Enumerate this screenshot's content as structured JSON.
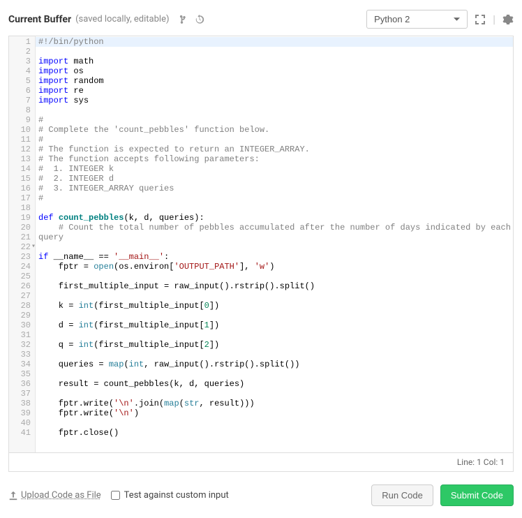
{
  "header": {
    "title": "Current Buffer",
    "subtitle": "(saved locally, editable)",
    "language": "Python 2"
  },
  "code_lines": [
    {
      "n": 1,
      "hl": true,
      "seg": [
        {
          "c": "tok-comment",
          "t": "#!/bin/python"
        }
      ]
    },
    {
      "n": 2,
      "seg": []
    },
    {
      "n": 3,
      "seg": [
        {
          "c": "tok-keyword",
          "t": "import"
        },
        {
          "t": " math"
        }
      ]
    },
    {
      "n": 4,
      "seg": [
        {
          "c": "tok-keyword",
          "t": "import"
        },
        {
          "t": " os"
        }
      ]
    },
    {
      "n": 5,
      "seg": [
        {
          "c": "tok-keyword",
          "t": "import"
        },
        {
          "t": " random"
        }
      ]
    },
    {
      "n": 6,
      "seg": [
        {
          "c": "tok-keyword",
          "t": "import"
        },
        {
          "t": " re"
        }
      ]
    },
    {
      "n": 7,
      "seg": [
        {
          "c": "tok-keyword",
          "t": "import"
        },
        {
          "t": " sys"
        }
      ]
    },
    {
      "n": 8,
      "seg": []
    },
    {
      "n": 9,
      "seg": [
        {
          "c": "tok-comment",
          "t": "#"
        }
      ]
    },
    {
      "n": 10,
      "seg": [
        {
          "c": "tok-comment",
          "t": "# Complete the 'count_pebbles' function below."
        }
      ]
    },
    {
      "n": 11,
      "seg": [
        {
          "c": "tok-comment",
          "t": "#"
        }
      ]
    },
    {
      "n": 12,
      "seg": [
        {
          "c": "tok-comment",
          "t": "# The function is expected to return an INTEGER_ARRAY."
        }
      ]
    },
    {
      "n": 13,
      "seg": [
        {
          "c": "tok-comment",
          "t": "# The function accepts following parameters:"
        }
      ]
    },
    {
      "n": 14,
      "seg": [
        {
          "c": "tok-comment",
          "t": "#  1. INTEGER k"
        }
      ]
    },
    {
      "n": 15,
      "seg": [
        {
          "c": "tok-comment",
          "t": "#  2. INTEGER d"
        }
      ]
    },
    {
      "n": 16,
      "seg": [
        {
          "c": "tok-comment",
          "t": "#  3. INTEGER_ARRAY queries"
        }
      ]
    },
    {
      "n": 17,
      "seg": [
        {
          "c": "tok-comment",
          "t": "#"
        }
      ]
    },
    {
      "n": 18,
      "seg": []
    },
    {
      "n": 19,
      "seg": [
        {
          "c": "tok-keyword",
          "t": "def"
        },
        {
          "t": " "
        },
        {
          "c": "tok-def",
          "t": "count_pebbles"
        },
        {
          "t": "(k, d, queries):"
        }
      ]
    },
    {
      "n": 20,
      "wrap": true,
      "seg": [
        {
          "t": "    "
        },
        {
          "c": "tok-comment",
          "t": "# Count the total number of pebbles accumulated after the number of days indicated by each query"
        }
      ]
    },
    {
      "n": 21,
      "seg": []
    },
    {
      "n": 22,
      "fold": true,
      "seg": [
        {
          "c": "tok-keyword",
          "t": "if"
        },
        {
          "t": " __name__ == "
        },
        {
          "c": "tok-string",
          "t": "'__main__'"
        },
        {
          "t": ":"
        }
      ]
    },
    {
      "n": 23,
      "seg": [
        {
          "t": "    fptr = "
        },
        {
          "c": "tok-builtin",
          "t": "open"
        },
        {
          "t": "(os.environ["
        },
        {
          "c": "tok-string",
          "t": "'OUTPUT_PATH'"
        },
        {
          "t": "], "
        },
        {
          "c": "tok-string",
          "t": "'w'"
        },
        {
          "t": ")"
        }
      ]
    },
    {
      "n": 24,
      "seg": []
    },
    {
      "n": 25,
      "seg": [
        {
          "t": "    first_multiple_input = raw_input().rstrip().split()"
        }
      ]
    },
    {
      "n": 26,
      "seg": []
    },
    {
      "n": 27,
      "seg": [
        {
          "t": "    k = "
        },
        {
          "c": "tok-builtin",
          "t": "int"
        },
        {
          "t": "(first_multiple_input["
        },
        {
          "c": "tok-num",
          "t": "0"
        },
        {
          "t": "])"
        }
      ]
    },
    {
      "n": 28,
      "seg": []
    },
    {
      "n": 29,
      "seg": [
        {
          "t": "    d = "
        },
        {
          "c": "tok-builtin",
          "t": "int"
        },
        {
          "t": "(first_multiple_input["
        },
        {
          "c": "tok-num",
          "t": "1"
        },
        {
          "t": "])"
        }
      ]
    },
    {
      "n": 30,
      "seg": []
    },
    {
      "n": 31,
      "seg": [
        {
          "t": "    q = "
        },
        {
          "c": "tok-builtin",
          "t": "int"
        },
        {
          "t": "(first_multiple_input["
        },
        {
          "c": "tok-num",
          "t": "2"
        },
        {
          "t": "])"
        }
      ]
    },
    {
      "n": 32,
      "seg": []
    },
    {
      "n": 33,
      "seg": [
        {
          "t": "    queries = "
        },
        {
          "c": "tok-builtin",
          "t": "map"
        },
        {
          "t": "("
        },
        {
          "c": "tok-builtin",
          "t": "int"
        },
        {
          "t": ", raw_input().rstrip().split())"
        }
      ]
    },
    {
      "n": 34,
      "seg": []
    },
    {
      "n": 35,
      "seg": [
        {
          "t": "    result = count_pebbles(k, d, queries)"
        }
      ]
    },
    {
      "n": 36,
      "seg": []
    },
    {
      "n": 37,
      "seg": [
        {
          "t": "    fptr.write("
        },
        {
          "c": "tok-string",
          "t": "'\\n'"
        },
        {
          "t": ".join("
        },
        {
          "c": "tok-builtin",
          "t": "map"
        },
        {
          "t": "("
        },
        {
          "c": "tok-builtin",
          "t": "str"
        },
        {
          "t": ", result)))"
        }
      ]
    },
    {
      "n": 38,
      "seg": [
        {
          "t": "    fptr.write("
        },
        {
          "c": "tok-string",
          "t": "'\\n'"
        },
        {
          "t": ")"
        }
      ]
    },
    {
      "n": 39,
      "seg": []
    },
    {
      "n": 40,
      "seg": [
        {
          "t": "    fptr.close()"
        }
      ]
    },
    {
      "n": 41,
      "seg": []
    }
  ],
  "status": "Line: 1 Col: 1",
  "footer": {
    "upload_label": "Upload Code as File",
    "test_label": "Test against custom input",
    "run_label": "Run Code",
    "submit_label": "Submit Code"
  }
}
